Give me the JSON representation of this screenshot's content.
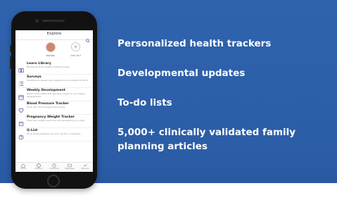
{
  "colors": {
    "background": "#2f63ad",
    "text": "#ffffff",
    "accent": "#5a3d98"
  },
  "phone": {
    "app_title": "Explore",
    "profiles": [
      {
        "name": "Ashley"
      },
      {
        "name": "Add Kid"
      }
    ],
    "menu": [
      {
        "icon": "book-icon",
        "title": "Learn Library",
        "desc": "Browse all of the health content by topic"
      },
      {
        "icon": "list-icon",
        "title": "Surveys",
        "desc": "Questions to assess your pregnancy and prepare for birth"
      },
      {
        "icon": "calendar-icon",
        "title": "Weekly Development",
        "desc": "Watch short videos and get daily insight on your baby's development"
      },
      {
        "icon": "heart-icon",
        "title": "Blood Pressure Tracker",
        "desc": "Track your blood pressure and pulse"
      },
      {
        "icon": "scale-icon",
        "title": "Pregnancy Weight Tracker",
        "desc": "Track your weight over time and see weekly on a chart"
      },
      {
        "icon": "question-icon",
        "title": "Q-List",
        "desc": "Store all the questions for your doctor in one place"
      }
    ],
    "tabs": [
      {
        "icon": "home-icon",
        "label": "Home"
      },
      {
        "icon": "explore-icon",
        "label": "Explore"
      },
      {
        "icon": "schedule-icon",
        "label": "Schedule"
      },
      {
        "icon": "messages-icon",
        "label": "Messages"
      },
      {
        "icon": "trackers-icon",
        "label": "Trackers"
      }
    ]
  },
  "features": [
    "Personalized health trackers",
    "Developmental updates",
    "To-do lists",
    "5,000+ clinically validated family",
    "planning articles"
  ]
}
